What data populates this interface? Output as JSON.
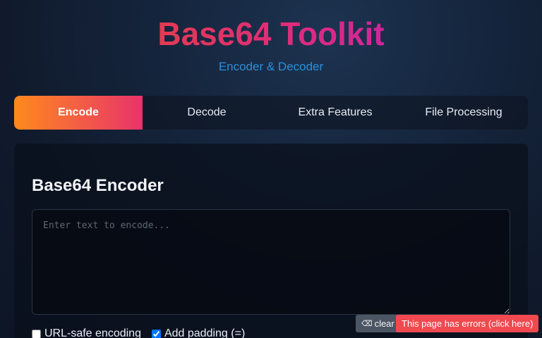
{
  "header": {
    "title": "Base64 Toolkit",
    "subtitle": "Encoder & Decoder"
  },
  "tabs": [
    {
      "label": "Encode",
      "active": true
    },
    {
      "label": "Decode",
      "active": false
    },
    {
      "label": "Extra Features",
      "active": false
    },
    {
      "label": "File Processing",
      "active": false
    }
  ],
  "encoder": {
    "title": "Base64 Encoder",
    "input": {
      "value": "",
      "placeholder": "Enter text to encode..."
    },
    "options": [
      {
        "label": "URL-safe encoding",
        "checked": false
      },
      {
        "label": "Add padding (=)",
        "checked": true
      }
    ]
  },
  "devtools": {
    "clear_icon": "trash-icon",
    "clear_label": "clear",
    "error_label": "This page has errors (click here)"
  },
  "colors": {
    "title_gradient": [
      "#e23b52",
      "#d0269a"
    ],
    "subtitle": "#2a8fdb",
    "active_tab_gradient": [
      "#ff8a1c",
      "#e9336a"
    ],
    "error_badge": "#f0494f"
  }
}
